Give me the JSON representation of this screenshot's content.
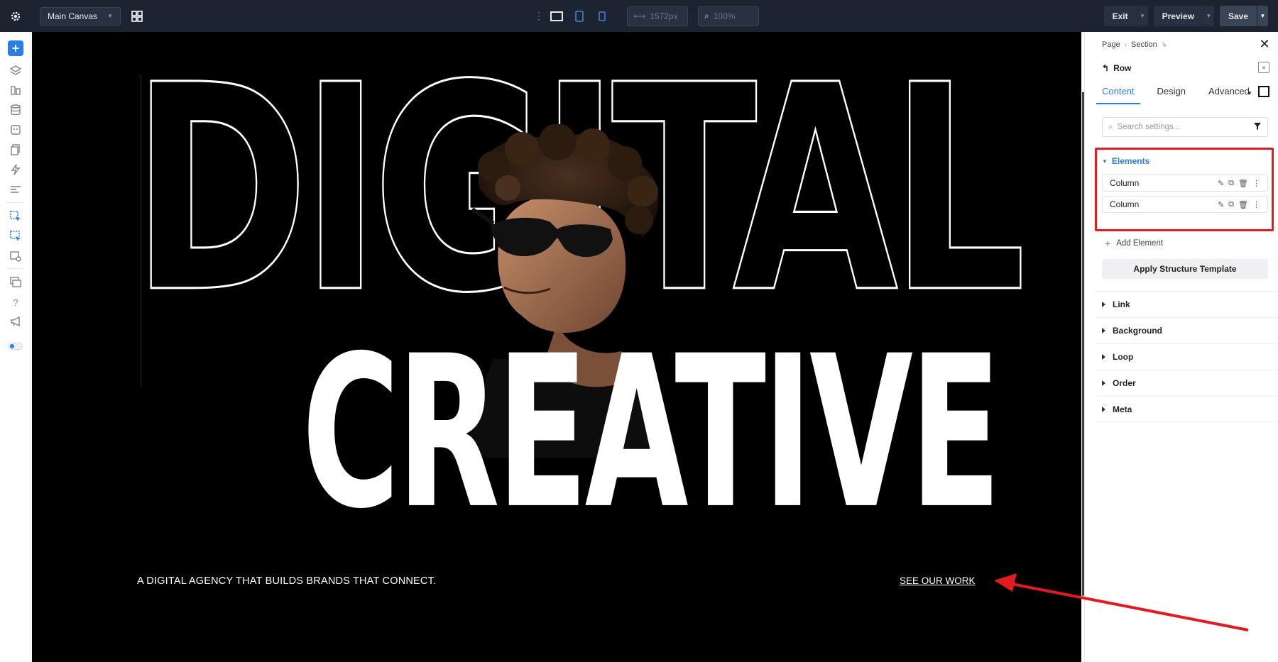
{
  "topbar": {
    "canvas_label": "Main Canvas",
    "width_value": "1572px",
    "zoom_value": "100%",
    "exit_label": "Exit",
    "preview_label": "Preview",
    "save_label": "Save"
  },
  "hero": {
    "headline_top": "DIGITAL",
    "headline_bottom": "CREATIVE",
    "tagline": "A DIGITAL AGENCY THAT BUILDS BRANDS THAT CONNECT.",
    "cta": "SEE OUR WORK"
  },
  "panel": {
    "breadcrumb": [
      "Page",
      "Section"
    ],
    "element_title": "Row",
    "tabs": [
      "Content",
      "Design",
      "Advanced"
    ],
    "search_placeholder": "Search settings...",
    "elements_heading": "Elements",
    "elements": [
      "Column",
      "Column"
    ],
    "add_element_label": "Add Element",
    "apply_template_label": "Apply Structure Template",
    "sections": [
      "Link",
      "Background",
      "Loop",
      "Order",
      "Meta"
    ]
  },
  "colors": {
    "accent": "#2b7de9",
    "highlight": "#e11b22",
    "topbar": "#1c2331"
  }
}
